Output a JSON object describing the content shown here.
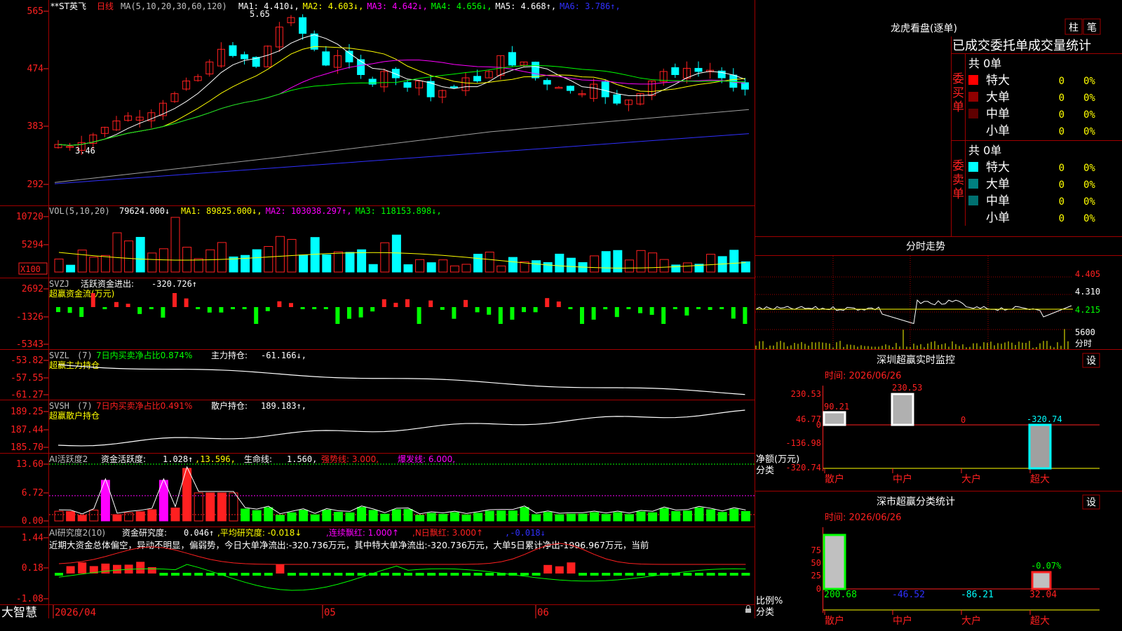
{
  "colors": {
    "bg": "#000000",
    "grid": "#a00000",
    "up": "#ff2020",
    "down": "#00ffff",
    "yellow": "#ffff00",
    "magenta": "#ff00ff",
    "green": "#00ff00",
    "white": "#ffffff",
    "gray": "#a0a0a0",
    "blue": "#3030ff",
    "label": "#c0c0c0"
  },
  "main": {
    "header": {
      "title": "**ST英飞",
      "period": "日线",
      "ma_params": "MA(5,10,20,30,60,120)",
      "items": [
        {
          "label": "MA1:",
          "value": "4.410↓",
          "color": "#ffffff"
        },
        {
          "label": "MA2:",
          "value": "4.603↓",
          "color": "#ffff00"
        },
        {
          "label": "MA3:",
          "value": "4.642↓",
          "color": "#ff00ff"
        },
        {
          "label": "MA4:",
          "value": "4.656↓",
          "color": "#00ff00"
        },
        {
          "label": "MA5:",
          "value": "4.668↑",
          "color": "#ffffff"
        },
        {
          "label": "MA6:",
          "value": "3.786↑",
          "color": "#3030ff"
        }
      ]
    },
    "y_ticks": [
      "565",
      "474",
      "383",
      "292"
    ],
    "annotations": {
      "high": "5.65",
      "low": "3.46"
    }
  },
  "vol": {
    "header": {
      "name": "VOL(5,10,20)",
      "value": "79624.000↓",
      "items": [
        {
          "label": "MA1:",
          "value": "89825.000↓",
          "color": "#ffff00"
        },
        {
          "label": "MA2:",
          "value": "103038.297↑",
          "color": "#ff00ff"
        },
        {
          "label": "MA3:",
          "value": "118153.898↓",
          "color": "#00ff00"
        }
      ]
    },
    "y_ticks": [
      "10720",
      "5294"
    ],
    "unit": "X100"
  },
  "svzj": {
    "header": {
      "name": "SVZJ",
      "label": "活跃资金进出:",
      "value": "-320.726↑",
      "sub": "超赢资金流(万元)"
    },
    "y_ticks": [
      "2692",
      "-1326",
      "-5343"
    ]
  },
  "svzl": {
    "header": {
      "name": "SVZL",
      "param": "(7)",
      "ratio": "7日内买卖净占比0.874%",
      "label": "主力持仓:",
      "value": "-61.166↓,",
      "sub": "超赢主力持仓"
    },
    "y_ticks": [
      "-53.82",
      "-57.55",
      "-61.27"
    ]
  },
  "svsh": {
    "header": {
      "name": "SVSH",
      "param": "(7)",
      "ratio": "7日内买卖净占比0.491%",
      "label": "散户持仓:",
      "value": "189.183↑,",
      "sub": "超赢散户持仓"
    },
    "y_ticks": [
      "189.25",
      "187.44",
      "185.70"
    ]
  },
  "ai1": {
    "header": {
      "name": "AI活跃度2",
      "label": "资金活跃度:",
      "value": "1.028↑",
      "v2": ",13.596,",
      "life_label": "生命线:",
      "life_value": "1.560,",
      "strong": "强势线: 3.000,",
      "burst": "爆发线: 6.000,"
    },
    "y_ticks": [
      "13.60",
      "6.72",
      "0.00"
    ]
  },
  "ai2": {
    "header": {
      "name": "AI研究度2(10)",
      "label": "资金研究度:",
      "value": "0.046↑",
      "avg": ",平均研究度: -0.018↓",
      "red": ",连续飘红: 1.000↑",
      "nred": ",N日飘红: 3.000↑",
      "last": ",-0.018↓"
    },
    "text": "近期大资金总体偏空，异动不明显，偏弱势，今日大单净流出:-320.736万元，其中特大单净流出:-320.736万元，大单5日累计净出-1996.967万元，当前",
    "y_ticks": [
      "1.44",
      "0.18",
      "-1.08"
    ]
  },
  "bottom": {
    "brand": "大智慧",
    "dates": [
      "2026/04",
      "05",
      "06"
    ]
  },
  "right": {
    "tabs": [
      "柱",
      "笔"
    ],
    "lhb_title": "龙虎看盘(逐单)",
    "stat_title": "已成交委托单成交量统计",
    "buy": {
      "side_label": "委买单",
      "total": "共 0单",
      "rows": [
        {
          "name": "特大",
          "count": "0",
          "pct": "0%",
          "color": "#ff0000"
        },
        {
          "name": "大单",
          "count": "0",
          "pct": "0%",
          "color": "#900000"
        },
        {
          "name": "中单",
          "count": "0",
          "pct": "0%",
          "color": "#600000"
        },
        {
          "name": "小单",
          "count": "0",
          "pct": "0%",
          "color": ""
        }
      ]
    },
    "sell": {
      "side_label": "委卖单",
      "total": "共 0单",
      "rows": [
        {
          "name": "特大",
          "count": "0",
          "pct": "0%",
          "color": "#00ffff"
        },
        {
          "name": "大单",
          "count": "0",
          "pct": "0%",
          "color": "#008080"
        },
        {
          "name": "中单",
          "count": "0",
          "pct": "0%",
          "color": "#007070"
        },
        {
          "name": "小单",
          "count": "0",
          "pct": "0%",
          "color": ""
        }
      ]
    },
    "fenshi": {
      "title": "分时走势",
      "prices": [
        "4.405",
        "4.310",
        "4.215"
      ],
      "vol_label": "5600",
      "vol_unit": "分时"
    },
    "monitor": {
      "title": "深圳超赢实时监控",
      "settings": "设",
      "time": "时间: 2026/06/26",
      "y_ticks": [
        "230.53",
        "46.77",
        "0",
        "-136.98",
        "-320.74"
      ],
      "y_label1": "净额(万元)",
      "y_label2": "分类",
      "categories": [
        "散户",
        "中户",
        "大户",
        "超大"
      ],
      "values": [
        90.21,
        230.53,
        0,
        -320.74
      ],
      "value_labels": [
        "90.21",
        "230.53",
        "0",
        "-320.74"
      ]
    },
    "classify": {
      "title": "深市超赢分类统计",
      "settings": "设",
      "time": "时间: 2026/06/26",
      "y_ticks": [
        "75",
        "50",
        "25",
        "0"
      ],
      "y_label1": "比例%",
      "y_label2": "分类",
      "categories": [
        "散户",
        "中户",
        "大户",
        "超大"
      ],
      "values": [
        200.68,
        -46.52,
        -86.21,
        32.04
      ],
      "value_labels": [
        "200.68",
        "-46.52",
        "-86.21",
        "32.04"
      ],
      "extra_label": "-0.07%"
    }
  }
}
